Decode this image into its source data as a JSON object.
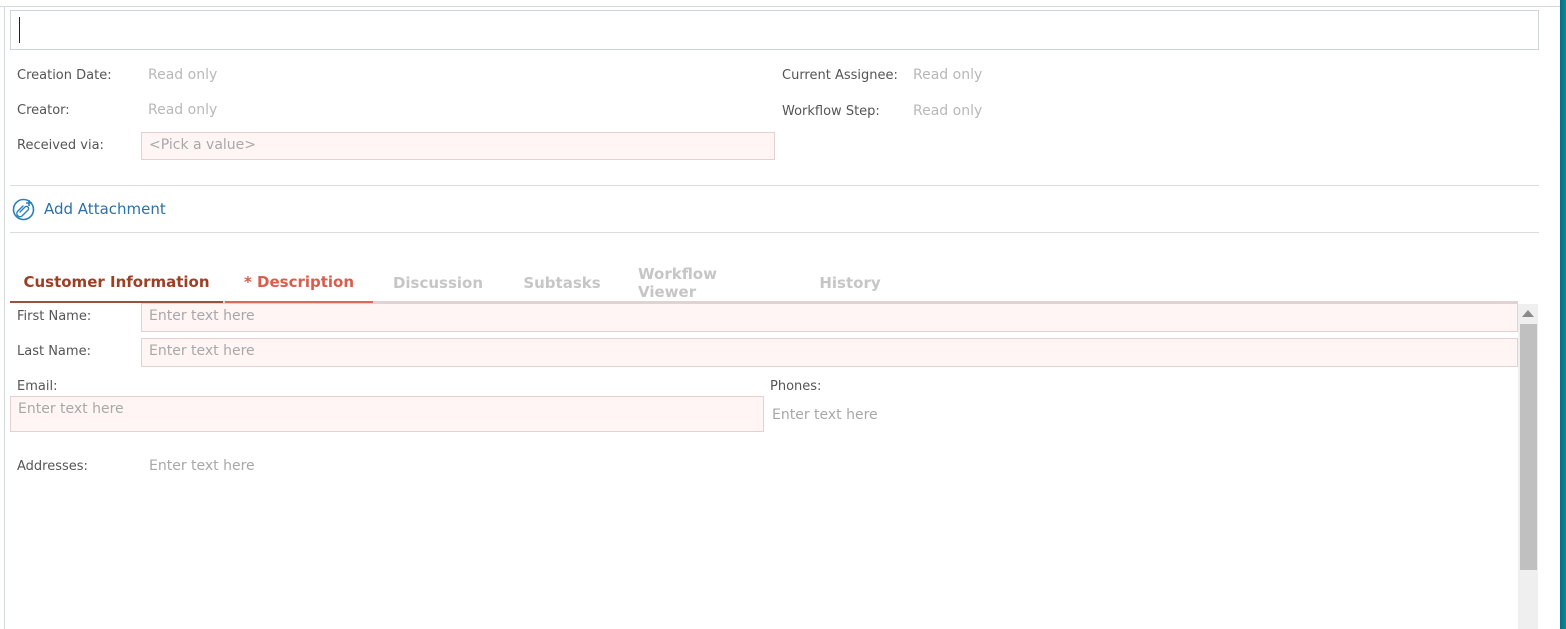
{
  "title_field": {
    "value": "",
    "placeholder": ""
  },
  "meta": {
    "creation_date": {
      "label": "Creation Date:",
      "value": "Read only"
    },
    "creator": {
      "label": "Creator:",
      "value": "Read only"
    },
    "received_via": {
      "label": "Received via:",
      "placeholder": "<Pick a value>"
    },
    "current_assignee": {
      "label": "Current Assignee:",
      "value": "Read only"
    },
    "workflow_step": {
      "label": "Workflow Step:",
      "value": "Read only"
    }
  },
  "attachment": {
    "label": "Add Attachment",
    "icon": "paperclip-add-icon"
  },
  "tabs": [
    {
      "label": "Customer Information",
      "state": "active"
    },
    {
      "label": "* Description",
      "state": "required"
    },
    {
      "label": "Discussion",
      "state": "disabled"
    },
    {
      "label": "Subtasks",
      "state": "disabled"
    },
    {
      "label": "Workflow Viewer",
      "state": "disabled"
    },
    {
      "label": "History",
      "state": "disabled"
    }
  ],
  "customer": {
    "first_name": {
      "label": "First Name:",
      "placeholder": "Enter text here"
    },
    "last_name": {
      "label": "Last Name:",
      "placeholder": "Enter text here"
    },
    "email": {
      "label": "Email:",
      "placeholder": "Enter text here"
    },
    "phones": {
      "label": "Phones:",
      "placeholder": "Enter text here"
    },
    "addresses": {
      "label": "Addresses:",
      "placeholder": "Enter text here"
    }
  },
  "colors": {
    "active_tab": "#9c3f25",
    "required_tab": "#d95c4c",
    "link": "#2a72a8",
    "required_field_bg": "#fff5f5",
    "required_field_border": "#e8cfd2"
  }
}
